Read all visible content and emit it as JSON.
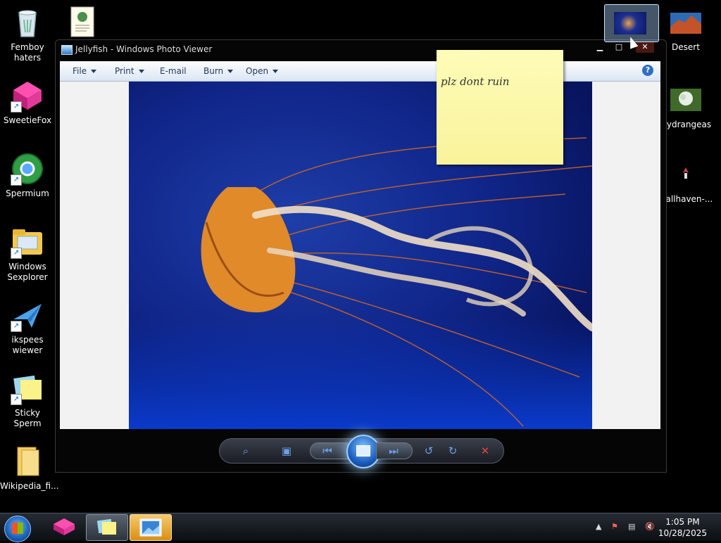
{
  "desktop": {
    "icons_left": [
      {
        "label": "Femboy haters",
        "icon": "recycle-bin-icon"
      },
      {
        "label": "SweetieFox",
        "icon": "sweetiefox-app-icon"
      },
      {
        "label": "Spermium",
        "icon": "browser-icon"
      },
      {
        "label": "Windows Sexplorer",
        "icon": "folder-explorer-icon"
      },
      {
        "label": "ikspees wiewer",
        "icon": "xps-viewer-icon"
      },
      {
        "label": "Sticky Sperm",
        "icon": "sticky-notes-icon"
      },
      {
        "label": "Wikipedia_fi...",
        "icon": "folder-icon"
      }
    ],
    "icons_right": [
      {
        "label": "Desert",
        "icon": "image-file-icon"
      },
      {
        "label": "Hydrangeas",
        "icon": "image-file-icon"
      },
      {
        "label": "wallhaven-...",
        "icon": "image-file-icon"
      }
    ]
  },
  "viewer": {
    "title": "Jellyfish - Windows Photo Viewer",
    "menu": [
      "File",
      "Print",
      "E-mail",
      "Burn",
      "Open"
    ],
    "help": "?",
    "window_buttons": {
      "minimize": "▁",
      "maximize": "□",
      "close": "✕"
    }
  },
  "sticky": {
    "text": "plz dont ruin"
  },
  "taskbar": {
    "time": "1:05 PM",
    "date": "10/28/2025"
  },
  "colors": {
    "photo_blue": "#10268a",
    "jelly_orange": "#e08a2a",
    "sticky_yellow": "#fdf9a8"
  }
}
